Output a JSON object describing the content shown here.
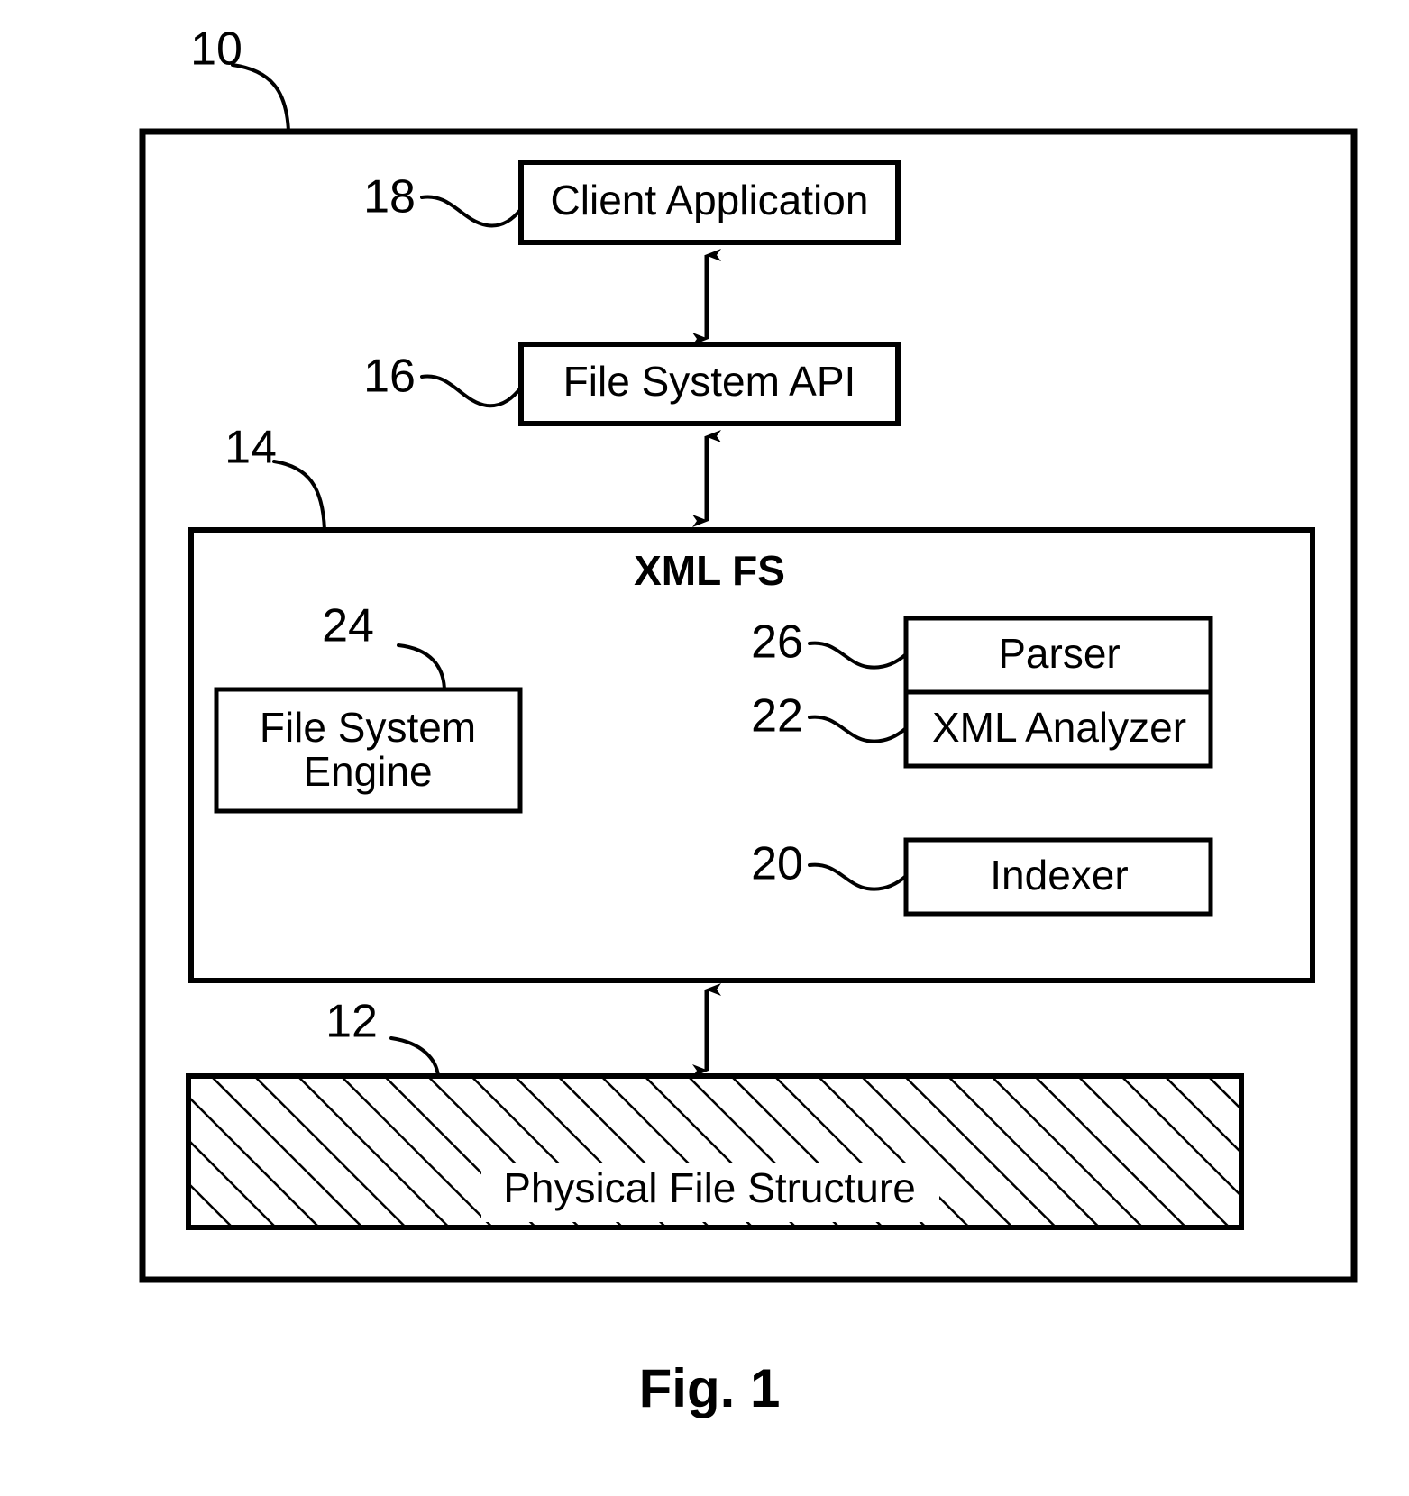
{
  "figure": {
    "caption": "Fig. 1",
    "system_ref": "10",
    "title": "XML FS"
  },
  "blocks": [
    {
      "id": "client-application",
      "label": "Client Application",
      "ref": "18"
    },
    {
      "id": "file-system-api",
      "label": "File System API",
      "ref": "16"
    },
    {
      "id": "xml-fs",
      "label": "XML FS",
      "ref": "14"
    },
    {
      "id": "file-system-engine",
      "label": "File System\nEngine",
      "label_line1": "File System",
      "label_line2": "Engine",
      "ref": "24"
    },
    {
      "id": "parser",
      "label": "Parser",
      "ref": "26"
    },
    {
      "id": "xml-analyzer",
      "label": "XML Analyzer",
      "ref": "22"
    },
    {
      "id": "indexer",
      "label": "Indexer",
      "ref": "20"
    },
    {
      "id": "physical-file-structure",
      "label": "Physical File Structure",
      "ref": "12"
    }
  ],
  "refs": {
    "system": "10",
    "client_application": "18",
    "file_system_api": "16",
    "xml_fs": "14",
    "file_system_engine": "24",
    "parser": "26",
    "xml_analyzer": "22",
    "indexer": "20",
    "physical_file_structure": "12"
  },
  "labels": {
    "client_application": "Client Application",
    "file_system_api": "File System API",
    "xml_fs_title": "XML FS",
    "file_system_engine_line1": "File System",
    "file_system_engine_line2": "Engine",
    "parser": "Parser",
    "xml_analyzer": "XML Analyzer",
    "indexer": "Indexer",
    "physical_file_structure": "Physical File Structure",
    "figure_caption": "Fig. 1"
  },
  "connections": [
    {
      "from": "client-application",
      "to": "file-system-api",
      "type": "double-arrow"
    },
    {
      "from": "file-system-api",
      "to": "xml-fs",
      "type": "double-arrow"
    },
    {
      "from": "xml-fs",
      "to": "physical-file-structure",
      "type": "double-arrow"
    }
  ],
  "colors": {
    "ink": "#000000",
    "paper": "#ffffff"
  }
}
